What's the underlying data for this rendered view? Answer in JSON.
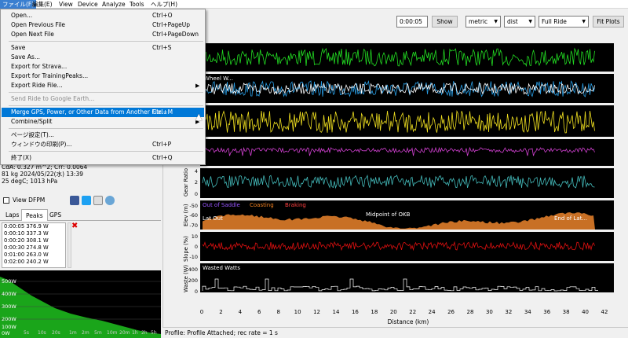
{
  "menubar": {
    "items": [
      "ファイル(F)",
      "編集(E)",
      "View",
      "Device",
      "Analyze",
      "Tools",
      "ヘルプ(H)"
    ]
  },
  "toolbar": {
    "time_value": "0:00:05",
    "show_label": "Show",
    "units_select": "metric",
    "xaxis_select": "dist",
    "range_select": "Full Ride",
    "fit_label": "Fit Plots"
  },
  "file_menu": {
    "items": [
      {
        "label": "Open...",
        "shortcut": "Ctrl+O"
      },
      {
        "label": "Open Previous File",
        "shortcut": "Ctrl+PageUp"
      },
      {
        "label": "Open Next File",
        "shortcut": "Ctrl+PageDown"
      },
      {
        "label": "Save",
        "shortcut": "Ctrl+S"
      },
      {
        "label": "Save As...",
        "shortcut": ""
      },
      {
        "label": "Export for Strava...",
        "shortcut": ""
      },
      {
        "label": "Export for TrainingPeaks...",
        "shortcut": ""
      },
      {
        "label": "Export Ride File...",
        "shortcut": ""
      },
      {
        "label": "Send Ride to Google Earth...",
        "shortcut": ""
      },
      {
        "label": "Merge GPS, Power, or Other Data from Another File...",
        "shortcut": "Ctrl+M"
      },
      {
        "label": "Combine/Split",
        "shortcut": ""
      },
      {
        "label": "ページ設定(T)...",
        "shortcut": ""
      },
      {
        "label": "ウィンドウの印刷(P)...",
        "shortcut": "Ctrl+P"
      },
      {
        "label": "終了(X)",
        "shortcut": "Ctrl+Q"
      }
    ]
  },
  "ride_info": {
    "line1": "CdA: 0.327 m^2; Crr: 0.0064",
    "line2": "81 kg 2024/05/22(水) 13:39",
    "line3": "25 degC; 1013 hPa"
  },
  "view_dfpm_label": "View DFPM",
  "tabs": [
    "Laps",
    "Peaks",
    "GPS"
  ],
  "peaks": [
    "0:00:05 376.9 W",
    "0:00:10 337.3 W",
    "0:00:20 308.1 W",
    "0:00:30 274.8 W",
    "0:01:00 263.0 W",
    "0:02:00 240.2 W"
  ],
  "peak_chart": {
    "y_ticks": [
      "500W",
      "400W",
      "300W",
      "200W",
      "100W",
      "0W"
    ],
    "x_ticks": [
      "5s",
      "10s",
      "20s",
      "1m",
      "2m",
      "5m",
      "10m",
      "20m",
      "1h",
      "2h",
      "5h"
    ]
  },
  "plots": {
    "track_labels": [
      "Wheel W...",
      "Gear Ratio",
      "Elev (m)",
      "Slope (%)",
      "Waste (W)"
    ],
    "gear_ticks": [
      "4",
      "2",
      "0"
    ],
    "elev_ticks": [
      "-50",
      "-60",
      "-70"
    ],
    "slope_ticks": [
      "10",
      "0",
      "-10"
    ],
    "waste_ticks": [
      "400",
      "200",
      "0"
    ],
    "elev_legend": [
      "Out of Saddle",
      "Coasting",
      "Braking"
    ],
    "elev_overlays": [
      "Lat Out",
      "Midpoint of OKB",
      "End of Lat..."
    ],
    "waste_title": "Wasted Watts",
    "x_ticks": [
      "0",
      "2",
      "4",
      "6",
      "8",
      "10",
      "12",
      "14",
      "16",
      "18",
      "20",
      "22",
      "24",
      "26",
      "28",
      "30",
      "32",
      "34",
      "36",
      "38",
      "40",
      "42"
    ],
    "x_label": "Distance (km)"
  },
  "status": "Profile: Profile Attached; rec rate = 1 s",
  "colors": {
    "speed": "#22dd22",
    "power": "#2a9fe6",
    "cadence": "#f0e020",
    "heart": "#d040d0",
    "elev": "#c87025",
    "slope": "#e01010",
    "waste": "#ffffff",
    "menu_highlight": "#0078d7"
  }
}
